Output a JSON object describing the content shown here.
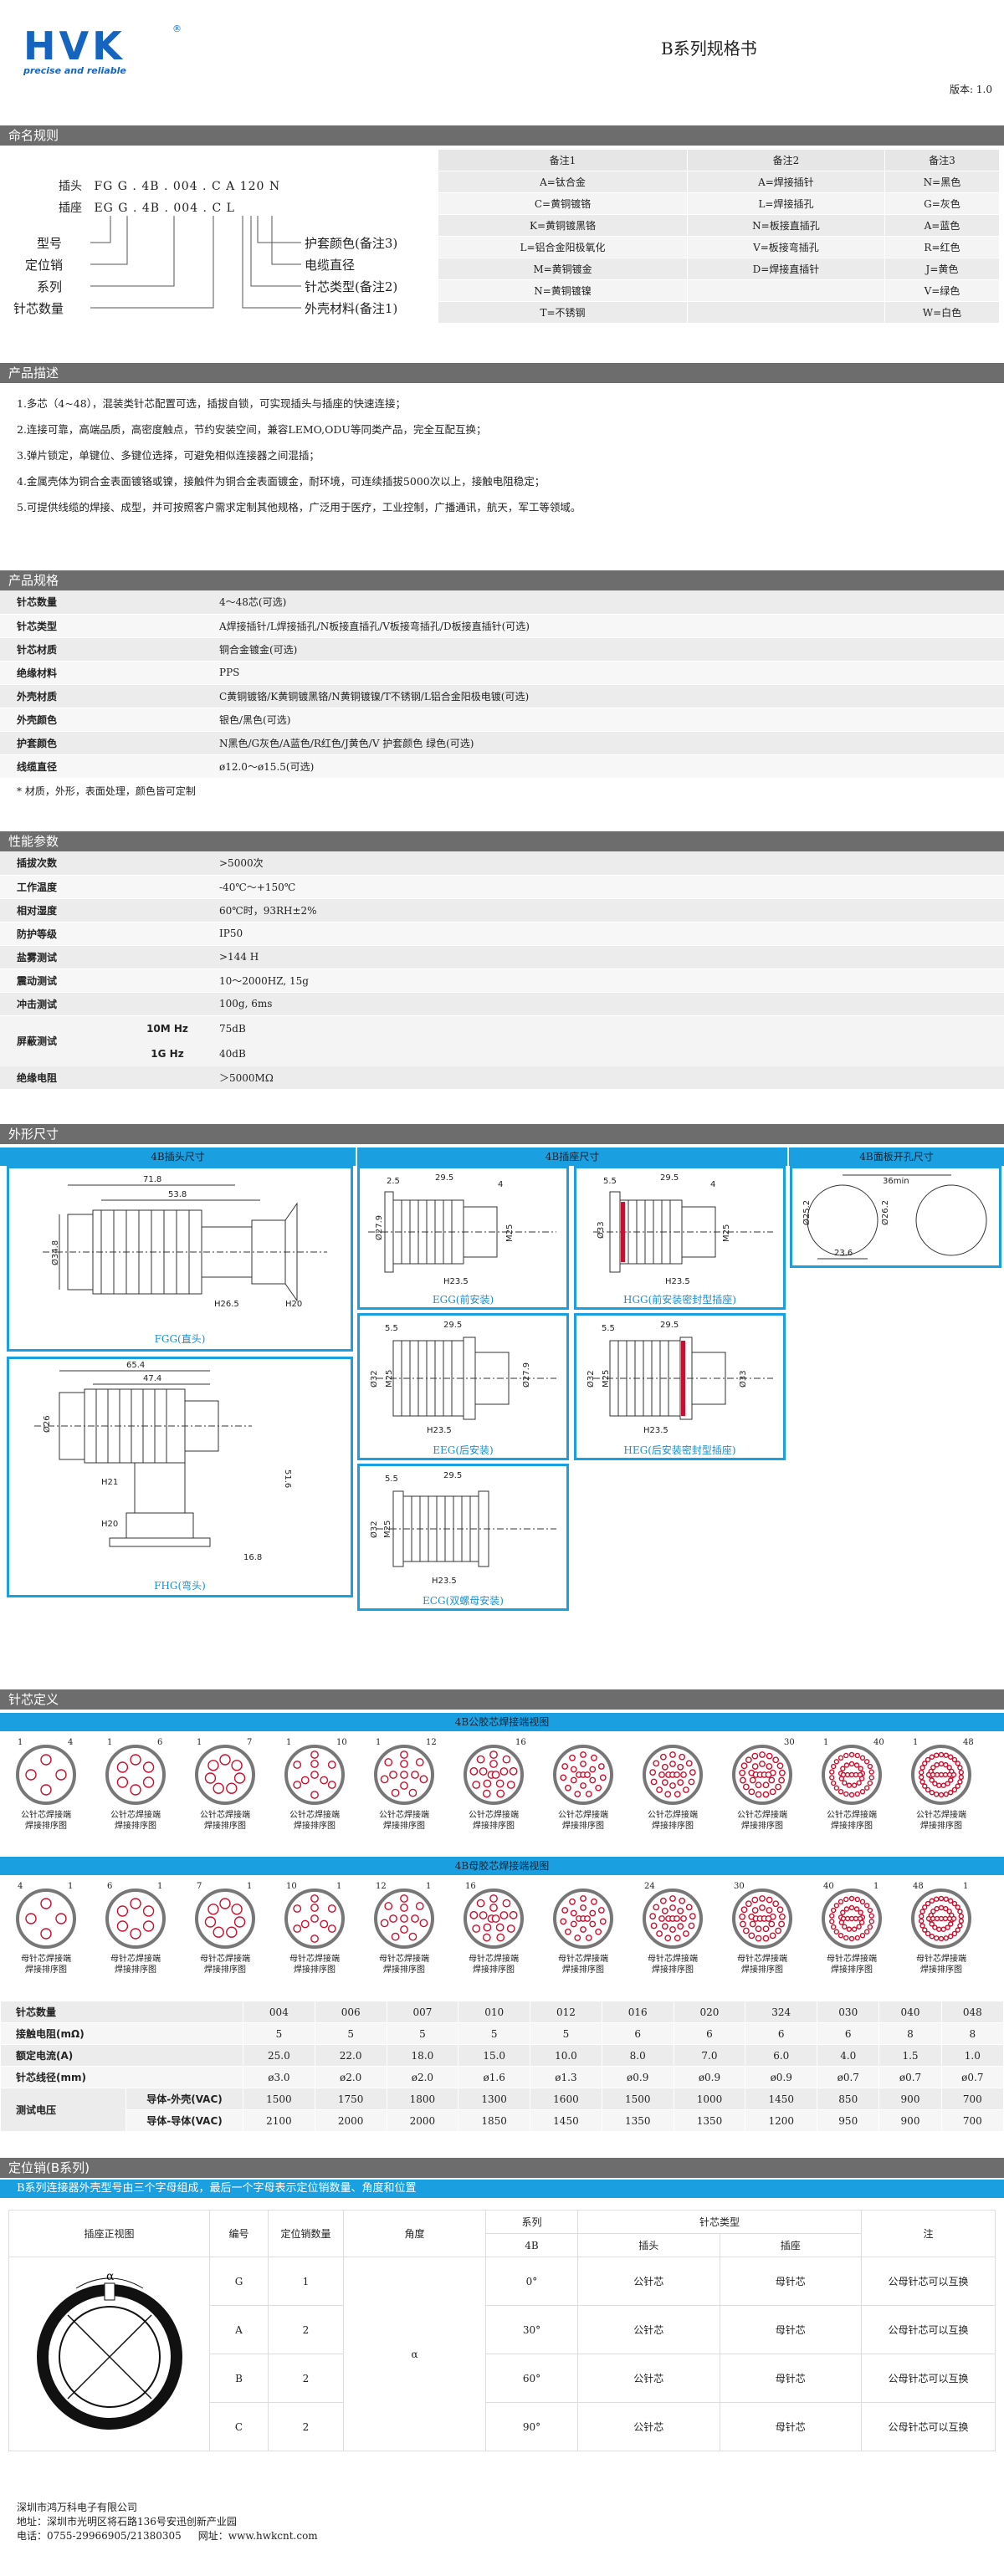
{
  "header": {
    "brand": "HVK",
    "reg": "®",
    "tagline": "precise and reliable",
    "title": "B系列规格书",
    "version": "版本: 1.0"
  },
  "naming": {
    "section": "命名规则",
    "plug_label": "插头",
    "plug_code": "FG G . 4B . 004 . C A 120 N",
    "socket_label": "插座",
    "socket_code": "EG G . 4B . 004 . C L",
    "left_labels": [
      "型号",
      "定位销",
      "系列",
      "针芯数量"
    ],
    "right_labels": [
      "护套颜色(备注3)",
      "电缆直径",
      "针芯类型(备注2)",
      "外壳材料(备注1)"
    ],
    "notes_headers": [
      "备注1",
      "备注2",
      "备注3"
    ],
    "notes_rows": [
      [
        "A=钛合金",
        "A=焊接插针",
        "N=黑色"
      ],
      [
        "C=黄铜镀铬",
        "L=焊接插孔",
        "G=灰色"
      ],
      [
        "K=黄铜镀黑铬",
        "N=板接直插孔",
        "A=蓝色"
      ],
      [
        "L=铝合金阳极氧化",
        "V=板接弯插孔",
        "R=红色"
      ],
      [
        "M=黄铜镀金",
        "D=焊接直插针",
        "J=黄色"
      ],
      [
        "N=黄铜镀镍",
        "",
        "V=绿色"
      ],
      [
        "T=不锈钢",
        "",
        "W=白色"
      ]
    ]
  },
  "description": {
    "section": "产品描述",
    "items": [
      "1.多芯（4~48），混装类针芯配置可选，插拔自锁，可实现插头与插座的快速连接；",
      "2.连接可靠，高端品质，高密度触点，节约安装空间，兼容LEMO,ODU等同类产品，完全互配互换；",
      "3.弹片锁定，单键位、多键位选择，可避免相似连接器之间混插；",
      "4.金属壳体为铜合金表面镀铬或镍，接触件为铜合金表面镀金，耐环境，可连续插拔5000次以上，接触电阻稳定；",
      "5.可提供线缆的焊接、成型，并可按照客户需求定制其他规格，广泛用于医疗，工业控制，广播通讯，航天，军工等领域。"
    ]
  },
  "specs": {
    "section": "产品规格",
    "rows": [
      [
        "针芯数量",
        "4～48芯(可选)"
      ],
      [
        "针芯类型",
        "A焊接插针/L焊接插孔/N板接直插孔/V板接弯插孔/D板接直插针(可选)"
      ],
      [
        "针芯材质",
        "铜合金镀金(可选)"
      ],
      [
        "绝缘材料",
        "PPS"
      ],
      [
        "外壳材质",
        "C黄铜镀铬/K黄铜镀黑铬/N黄铜镀镍/T不锈钢/L铝合金阳极电镀(可选)"
      ],
      [
        "外壳颜色",
        "银色/黑色(可选)"
      ],
      [
        "护套颜色",
        "N黑色/G灰色/A蓝色/R红色/J黄色/V 护套颜色 绿色(可选)"
      ],
      [
        "线缆直径",
        "ø12.0～ø15.5(可选)"
      ]
    ],
    "footnote": "* 材质，外形，表面处理，颜色皆可定制"
  },
  "performance": {
    "section": "性能参数",
    "rows": [
      [
        "插拔次数",
        ">5000次"
      ],
      [
        "工作温度",
        "-40℃～+150℃"
      ],
      [
        "相对湿度",
        "60℃时，93RH±2%"
      ],
      [
        "防护等级",
        "IP50"
      ],
      [
        "盐雾测试",
        ">144 H"
      ],
      [
        "震动测试",
        "10～2000HZ, 15g"
      ],
      [
        "冲击测试",
        "100g, 6ms"
      ]
    ],
    "shield_label": "屏蔽测试",
    "shield_rows": [
      [
        "10M Hz",
        "75dB"
      ],
      [
        "1G Hz",
        "40dB"
      ]
    ],
    "insulation": [
      "绝缘电阻",
      "＞5000MΩ"
    ]
  },
  "dimensions": {
    "section": "外形尺寸",
    "bars": [
      "4B插头尺寸",
      "4B插座尺寸",
      "4B面板开孔尺寸"
    ],
    "captions": {
      "fgg": "FGG(直头)",
      "egg": "EGG(前安装)",
      "hgg": "HGG(前安装密封型插座)",
      "eeg": "EEG(后安装)",
      "heg": "HEG(后安装密封型插座)",
      "fhg": "FHG(弯头)",
      "ecg": "ECG(双螺母安装)"
    },
    "labels": {
      "fgg": [
        "71.8",
        "53.8",
        "Ø34.8",
        "H26.5",
        "H20"
      ],
      "egg": [
        "2.5",
        "29.5",
        "4",
        "Ø27.9",
        "M25",
        "H23.5"
      ],
      "hgg": [
        "5.5",
        "29.5",
        "4",
        "Ø33",
        "M25",
        "H23.5"
      ],
      "panel": [
        "36min",
        "Ø25.2",
        "23.6",
        "Ø26.2"
      ],
      "fhg": [
        "65.4",
        "47.4",
        "Ø26",
        "H21",
        "H20",
        "51.6",
        "16.8"
      ],
      "eeg": [
        "5.5",
        "29.5",
        "Ø32",
        "Ø27.9",
        "M25",
        "H23.5"
      ],
      "heg": [
        "5.5",
        "29.5",
        "Ø32",
        "M25",
        "Ø33",
        "H23.5"
      ],
      "ecg": [
        "5.5",
        "29.5",
        "Ø32",
        "M25",
        "H23.5"
      ]
    }
  },
  "pins": {
    "section": "针芯定义",
    "male_bar": "4B公胶芯焊接端视图",
    "female_bar": "4B母胶芯焊接端视图",
    "male_caption": [
      "公针芯焊接端",
      "焊接排序图"
    ],
    "female_caption": [
      "母针芯焊接端",
      "焊接排序图"
    ],
    "male_counts": [
      [
        "1",
        "4"
      ],
      [
        "1",
        "6"
      ],
      [
        "1",
        "7"
      ],
      [
        "1",
        "10"
      ],
      [
        "1",
        "12"
      ],
      [
        "",
        "16"
      ],
      [
        "",
        ""
      ],
      [
        "",
        ""
      ],
      [
        "",
        "30"
      ],
      [
        "1",
        "40"
      ],
      [
        "1",
        "48"
      ]
    ],
    "female_counts": [
      [
        "4",
        "1"
      ],
      [
        "6",
        "1"
      ],
      [
        "7",
        "1"
      ],
      [
        "10",
        "1"
      ],
      [
        "12",
        "1"
      ],
      [
        "16",
        ""
      ],
      [
        "",
        ""
      ],
      [
        "24",
        ""
      ],
      [
        "30",
        ""
      ],
      [
        "40",
        "1"
      ],
      [
        "48",
        "1"
      ]
    ],
    "pin_numbers": [
      4,
      6,
      7,
      10,
      12,
      16,
      20,
      24,
      30,
      40,
      48
    ],
    "table": {
      "rows": [
        {
          "label": "针芯数量",
          "vals": [
            "004",
            "006",
            "007",
            "010",
            "012",
            "016",
            "020",
            "324",
            "030",
            "040",
            "048"
          ]
        },
        {
          "label": "接触电阻(mΩ)",
          "vals": [
            "5",
            "5",
            "5",
            "5",
            "5",
            "6",
            "6",
            "6",
            "6",
            "8",
            "8"
          ]
        },
        {
          "label": "额定电流(A)",
          "vals": [
            "25.0",
            "22.0",
            "18.0",
            "15.0",
            "10.0",
            "8.0",
            "7.0",
            "6.0",
            "4.0",
            "1.5",
            "1.0"
          ]
        },
        {
          "label": "针芯线径(mm)",
          "vals": [
            "ø3.0",
            "ø2.0",
            "ø2.0",
            "ø1.6",
            "ø1.3",
            "ø0.9",
            "ø0.9",
            "ø0.9",
            "ø0.7",
            "ø0.7",
            "ø0.7"
          ]
        }
      ],
      "test_label": "测试电压",
      "test_rows": [
        {
          "label": "导体-外壳(VAC)",
          "vals": [
            "1500",
            "1750",
            "1800",
            "1300",
            "1600",
            "1500",
            "1000",
            "1450",
            "850",
            "900",
            "700"
          ]
        },
        {
          "label": "导体-导体(VAC)",
          "vals": [
            "2100",
            "2000",
            "2000",
            "1850",
            "1450",
            "1350",
            "1350",
            "1200",
            "950",
            "900",
            "700"
          ]
        }
      ]
    }
  },
  "locator": {
    "section": "定位销(B系列)",
    "bar": "B系列连接器外壳型号由三个字母组成，最后一个字母表示定位销数量、角度和位置",
    "headers": [
      "插座正视图",
      "编号",
      "定位销数量",
      "角度",
      "系列",
      "针芯类型",
      "注"
    ],
    "sub_headers": [
      "4B",
      "插头",
      "插座"
    ],
    "alpha": "α",
    "rows": [
      [
        "G",
        "1",
        "0°",
        "公针芯",
        "母针芯",
        "公母针芯可以互换"
      ],
      [
        "A",
        "2",
        "30°",
        "公针芯",
        "母针芯",
        "公母针芯可以互换"
      ],
      [
        "B",
        "2",
        "60°",
        "公针芯",
        "母针芯",
        "公母针芯可以互换"
      ],
      [
        "C",
        "2",
        "90°",
        "公针芯",
        "母针芯",
        "公母针芯可以互换"
      ]
    ]
  },
  "footer": {
    "company": "深圳市鸿万科电子有限公司",
    "address": "地址：深圳市光明区将石路136号安迅创新产业园",
    "phone": "电话：0755-29966905/21380305",
    "web": "网址：www.hwkcnt.com"
  },
  "colors": {
    "blue": "#1a9fe0",
    "grey": "#6d6d6d",
    "red": "#c8102e"
  }
}
